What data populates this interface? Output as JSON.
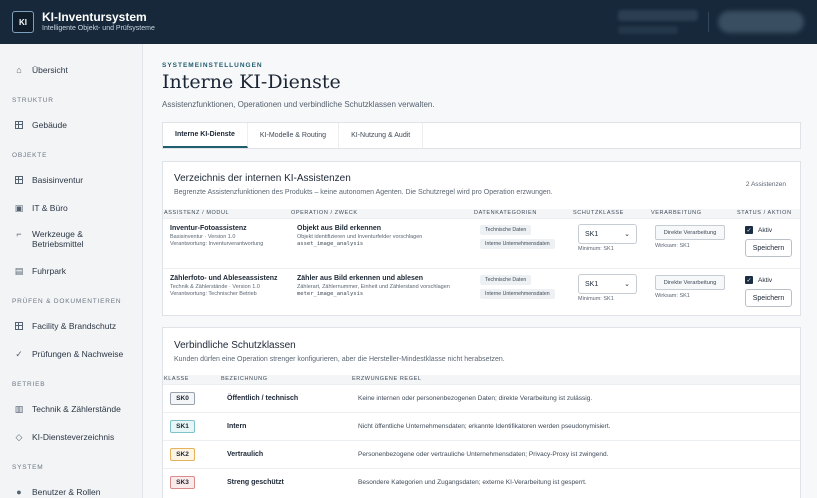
{
  "header": {
    "logo": "KI",
    "title": "KI-Inventursystem",
    "subtitle": "Intelligente Objekt- und Prüfsysteme"
  },
  "sidebar": {
    "overview": "Übersicht",
    "sections": [
      {
        "title": "STRUKTUR",
        "items": [
          "Gebäude"
        ]
      },
      {
        "title": "OBJEKTE",
        "items": [
          "Basisinventur",
          "IT & Büro",
          "Werkzeuge &",
          "Betriebsmittel",
          "Fuhrpark"
        ]
      },
      {
        "title": "PRÜFEN & DOKUMENTIEREN",
        "items": [
          "Facility & Brandschutz",
          "Prüfungen & Nachweise"
        ]
      },
      {
        "title": "BETRIEB",
        "items": [
          "Technik & Zählerstände",
          "KI-Diensteverzeichnis"
        ]
      },
      {
        "title": "SYSTEM",
        "items": [
          "Benutzer & Rollen"
        ]
      }
    ]
  },
  "page": {
    "eyebrow": "SYSTEMEINSTELLUNGEN",
    "title": "Interne KI-Dienste",
    "subtitle": "Assistenzfunktionen, Operationen und verbindliche Schutzklassen verwalten."
  },
  "tabs": [
    "Interne KI-Dienste",
    "KI-Modelle & Routing",
    "KI-Nutzung & Audit"
  ],
  "assistants": {
    "title": "Verzeichnis der internen KI-Assistenzen",
    "desc": "Begrenzte Assistenzfunktionen des Produkts – keine autonomen Agenten. Die Schutzregel wird pro Operation erzwungen.",
    "count": "2 Assistenzen",
    "columns": [
      "ASSISTENZ / MODUL",
      "OPERATION / ZWECK",
      "DATENKATEGORIEN",
      "SCHUTZKLASSE",
      "VERARBEITUNG",
      "STATUS / AKTION"
    ],
    "rows": [
      {
        "name": "Inventur-Fotoassistenz",
        "module": "Basisinventur · Version 1.0",
        "owner": "Verantwortung: Inventurverantwortung",
        "op": "Objekt aus Bild erkennen",
        "op_desc": "Objekt identifizieren und Inventurfelder vorschlagen",
        "op_code": "asset_image_analysis",
        "chips": [
          "Technische Daten",
          "Interne Unternehmensdaten"
        ],
        "class": "SK1",
        "min": "Minimum: SK1",
        "processing": "Direkte Verarbeitung",
        "effective": "Wirksam: SK1",
        "status": "Aktiv",
        "save": "Speichern"
      },
      {
        "name": "Zählerfoto- und Ableseassistenz",
        "module": "Technik & Zählerstände · Version 1.0",
        "owner": "Verantwortung: Technischer Betrieb",
        "op": "Zähler aus Bild erkennen und ablesen",
        "op_desc": "Zählerart, Zählernummer, Einheit und Zählerstand vorschlagen",
        "op_code": "meter_image_analysis",
        "chips": [
          "Technische Daten",
          "Interne Unternehmensdaten"
        ],
        "class": "SK1",
        "min": "Minimum: SK1",
        "processing": "Direkte Verarbeitung",
        "effective": "Wirksam: SK1",
        "status": "Aktiv",
        "save": "Speichern"
      }
    ]
  },
  "classes": {
    "title": "Verbindliche Schutzklassen",
    "desc": "Kunden dürfen eine Operation strenger konfigurieren, aber die Hersteller-Mindestklasse nicht herabsetzen.",
    "columns": [
      "KLASSE",
      "BEZEICHNUNG",
      "ERZWUNGENE REGEL"
    ],
    "rows": [
      {
        "code": "SK0",
        "name": "Öffentlich / technisch",
        "rule": "Keine internen oder personenbezogenen Daten; direkte Verarbeitung ist zulässig."
      },
      {
        "code": "SK1",
        "name": "Intern",
        "rule": "Nicht öffentliche Unternehmensdaten; erkannte Identifikatoren werden pseudonymisiert."
      },
      {
        "code": "SK2",
        "name": "Vertraulich",
        "rule": "Personenbezogene oder vertrauliche Unternehmensdaten; Privacy-Proxy ist zwingend."
      },
      {
        "code": "SK3",
        "name": "Streng geschützt",
        "rule": "Besondere Kategorien und Zugangsdaten; externe KI-Verarbeitung ist gesperrt."
      }
    ]
  },
  "icons": {
    "overview": "home-icon",
    "chevron": "chevron-down-icon",
    "check": "check-icon"
  }
}
